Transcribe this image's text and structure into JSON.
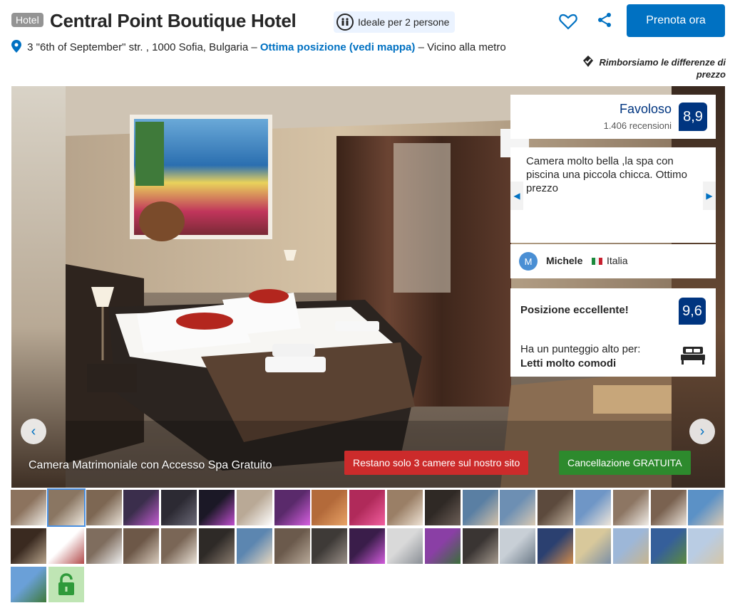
{
  "header": {
    "type_badge": "Hotel",
    "title": "Central Point Boutique Hotel",
    "ideal_label": "Ideale per 2 persone",
    "reserve_label": "Prenota ora"
  },
  "address": {
    "text": "3 \"6th of September\" str. , 1000 Sofia, Bulgaria –",
    "link": "Ottima posizione (vedi mappa)",
    "suffix": "– Vicino alla metro"
  },
  "refund_note": "Rimborsiamo le differenze di prezzo",
  "gallery": {
    "caption": "Camera Matrimoniale con Accesso Spa Gratuito",
    "scarcity_tag": "Restano solo 3 camere sul nostro sito",
    "cancel_tag": "Cancellazione GRATUITA"
  },
  "rating": {
    "word": "Favoloso",
    "reviews": "1.406 recensioni",
    "score": "8,9"
  },
  "review": {
    "text": "Camera molto bella ,la spa con piscina una piccola chicca. Ottimo prezzo",
    "avatar_letter": "M",
    "name": "Michele",
    "country": "Italia"
  },
  "location": {
    "title": "Posizione eccellente!",
    "score": "9,6",
    "sub": "Ha un punteggio alto per:",
    "highlight": "Letti molto comodi"
  },
  "colors": {
    "brand": "#0071c2",
    "score_bg": "#003580",
    "scarcity": "#cc2b2b",
    "free_cancel": "#2d8a2d"
  },
  "thumbnails": {
    "count": 40,
    "selected_index": 1
  }
}
